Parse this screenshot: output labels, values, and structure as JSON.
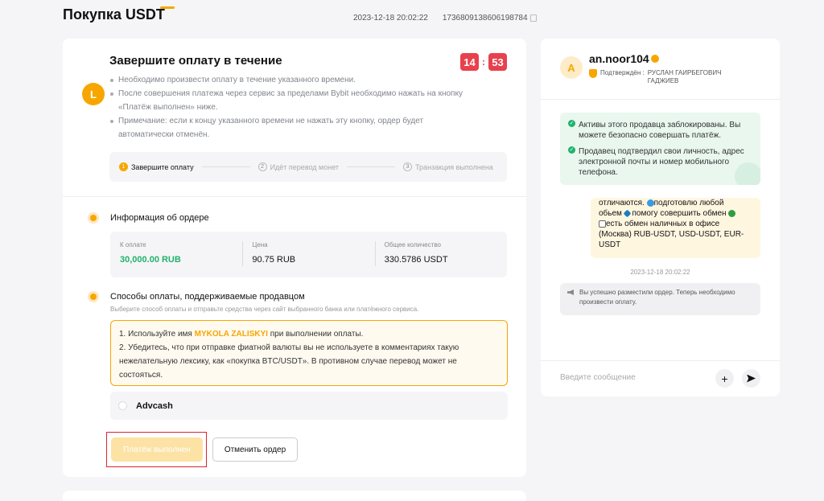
{
  "header": {
    "title": "Покупка USDT",
    "datetime": "2023-12-18 20:02:22",
    "order_id": "1736809138606198784"
  },
  "payment": {
    "avatar_letter": "L",
    "title": "Завершите оплату в течение",
    "timer_min": "14",
    "timer_sec": "53",
    "bullets": [
      "Необходимо произвести оплату в течение указанного времени.",
      "После совершения платежа через сервис за пределами Bybit необходимо нажать на кнопку «Платёж выполнен» ниже.",
      "Примечание: если к концу указанного времени не нажать эту кнопку, ордер будет автоматически отменён."
    ],
    "steps": [
      {
        "num": "1",
        "label": "Завершите оплату"
      },
      {
        "num": "2",
        "label": "Идёт перевод монет"
      },
      {
        "num": "3",
        "label": "Транзакция выполнена"
      }
    ]
  },
  "order_info": {
    "title": "Информация об ордере",
    "amount_label": "К оплате",
    "amount_value": "30,000.00 RUB",
    "price_label": "Цена",
    "price_value": "90.75 RUB",
    "qty_label": "Общее количество",
    "qty_value": "330.5786 USDT"
  },
  "methods": {
    "title": "Способы оплаты, поддерживаемые продавцом",
    "subtitle": "Выберите способ оплаты и отправьте средства через сайт выбранного банка или платёжного сервиса.",
    "notice_1_pre": "1. Используйте имя ",
    "notice_1_name": "MYKOLA ZALISKYI",
    "notice_1_post": " при выполнении оплаты.",
    "notice_2": "2. Убедитесь, что при отправке фиатной валюты вы не используете в комментариях такую нежелательную лексику, как «покупка BTC/USDT». В противном случае перевод может не состояться.",
    "method_name": "Advcash"
  },
  "actions": {
    "done_label": "Платёж выполнен",
    "cancel_label": "Отменить ордер"
  },
  "chat": {
    "avatar_letter": "A",
    "name": "an.noor104",
    "verified_label": "Подтверждён :",
    "verified_name": "РУСЛАН ГАИРБЕГОВИЧ ГАДЖИЕВ",
    "notice_1": "Активы этого продавца заблокированы. Вы можете безопасно совершать платёж.",
    "notice_2": "Продавец подтвердил свои личность, адрес электронной почты и номер мобильного телефона.",
    "msg_line1": "отличаются.",
    "msg_line1b": "подготовлю любой",
    "msg_line2a": "обьем",
    "msg_line2b": "помогу совершить обмен",
    "msg_line3": "есть обмен наличных в офисе (Москва) RUB-USDT, USD-USDT, EUR-USDT",
    "msg_time": "2023-12-18 20:02:22",
    "system_msg": "Вы успешно разместили ордер. Теперь необходимо произвести оплату.",
    "input_placeholder": "Введите сообщение"
  }
}
